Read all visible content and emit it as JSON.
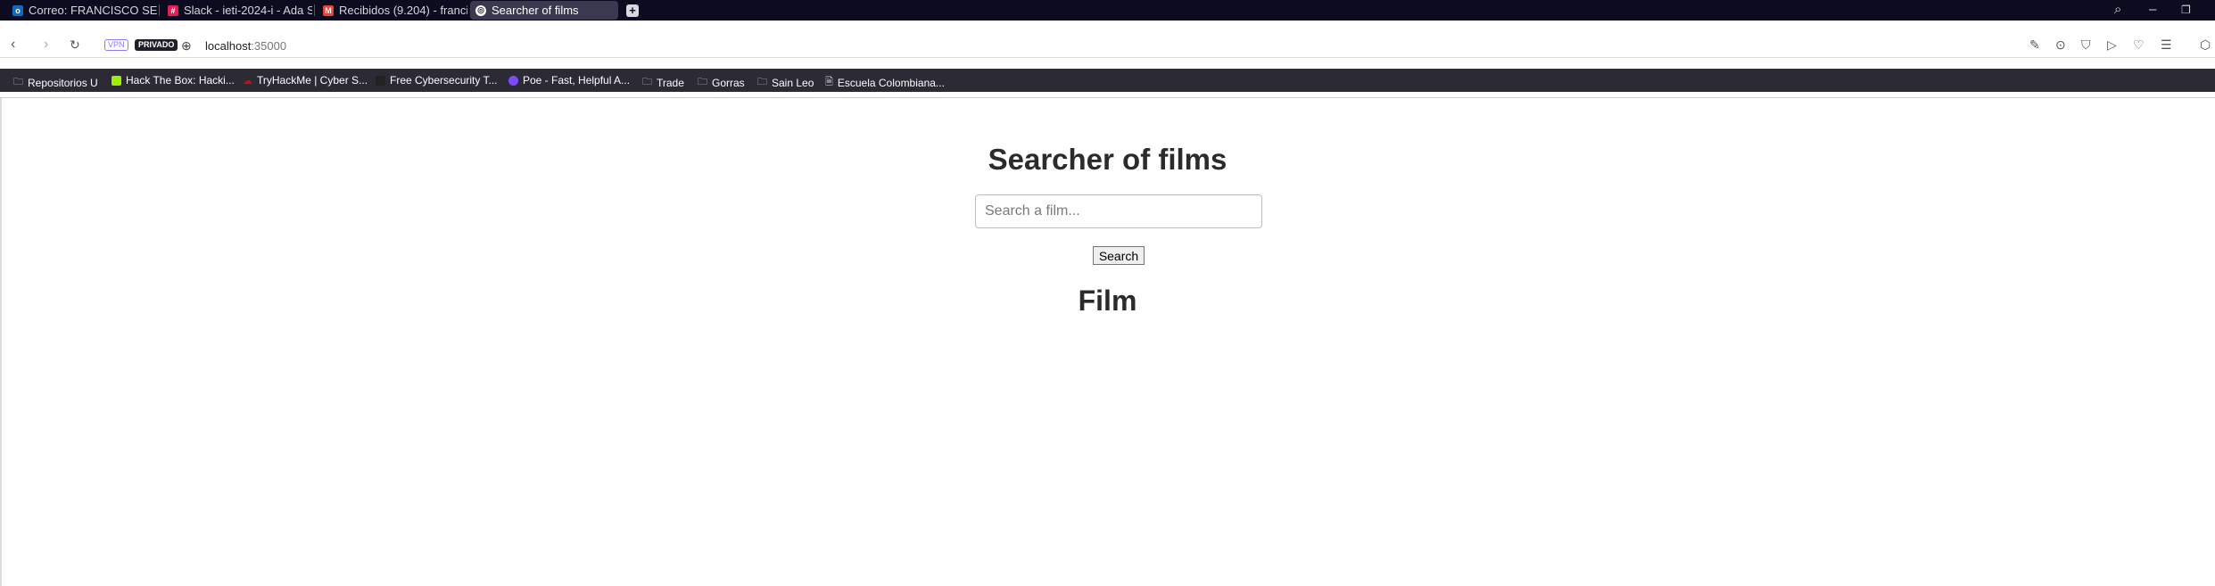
{
  "tabs": [
    {
      "label": "Correo: FRANCISCO SEBA...",
      "icon": "outlook-icon",
      "color": "#0f6cbd"
    },
    {
      "label": "Slack - ieti-2024-i - Ada Sc...",
      "icon": "slack-icon",
      "color": "#e01e5a"
    },
    {
      "label": "Recibidos (9.204) - francis...",
      "icon": "gmail-icon",
      "color": "#ea4335"
    },
    {
      "label": "Searcher of films",
      "icon": "globe-icon",
      "color": "#ffffff"
    }
  ],
  "address_bar": {
    "vpn": "VPN",
    "private": "PRIVADO",
    "host": "localhost",
    "port": ":35000"
  },
  "bookmarks": [
    {
      "label": "Repositorios U",
      "icon": "folder-icon"
    },
    {
      "label": "Hack The Box: Hacki...",
      "icon": "htb-icon",
      "color": "#9fef00"
    },
    {
      "label": "TryHackMe | Cyber S...",
      "icon": "thm-icon",
      "color": "#c11111"
    },
    {
      "label": "Free Cybersecurity T...",
      "icon": "site-icon",
      "color": "#222222"
    },
    {
      "label": "Poe - Fast, Helpful A...",
      "icon": "poe-icon",
      "color": "#7c4dff"
    },
    {
      "label": "Trade",
      "icon": "folder-icon"
    },
    {
      "label": "Gorras",
      "icon": "folder-icon"
    },
    {
      "label": "Sain Leo",
      "icon": "folder-icon"
    },
    {
      "label": "Escuela Colombiana...",
      "icon": "page-icon"
    }
  ],
  "page": {
    "title": "Searcher of films",
    "search_placeholder": "Search a film...",
    "search_value": "",
    "search_button": "Search",
    "result_heading": "Film"
  }
}
